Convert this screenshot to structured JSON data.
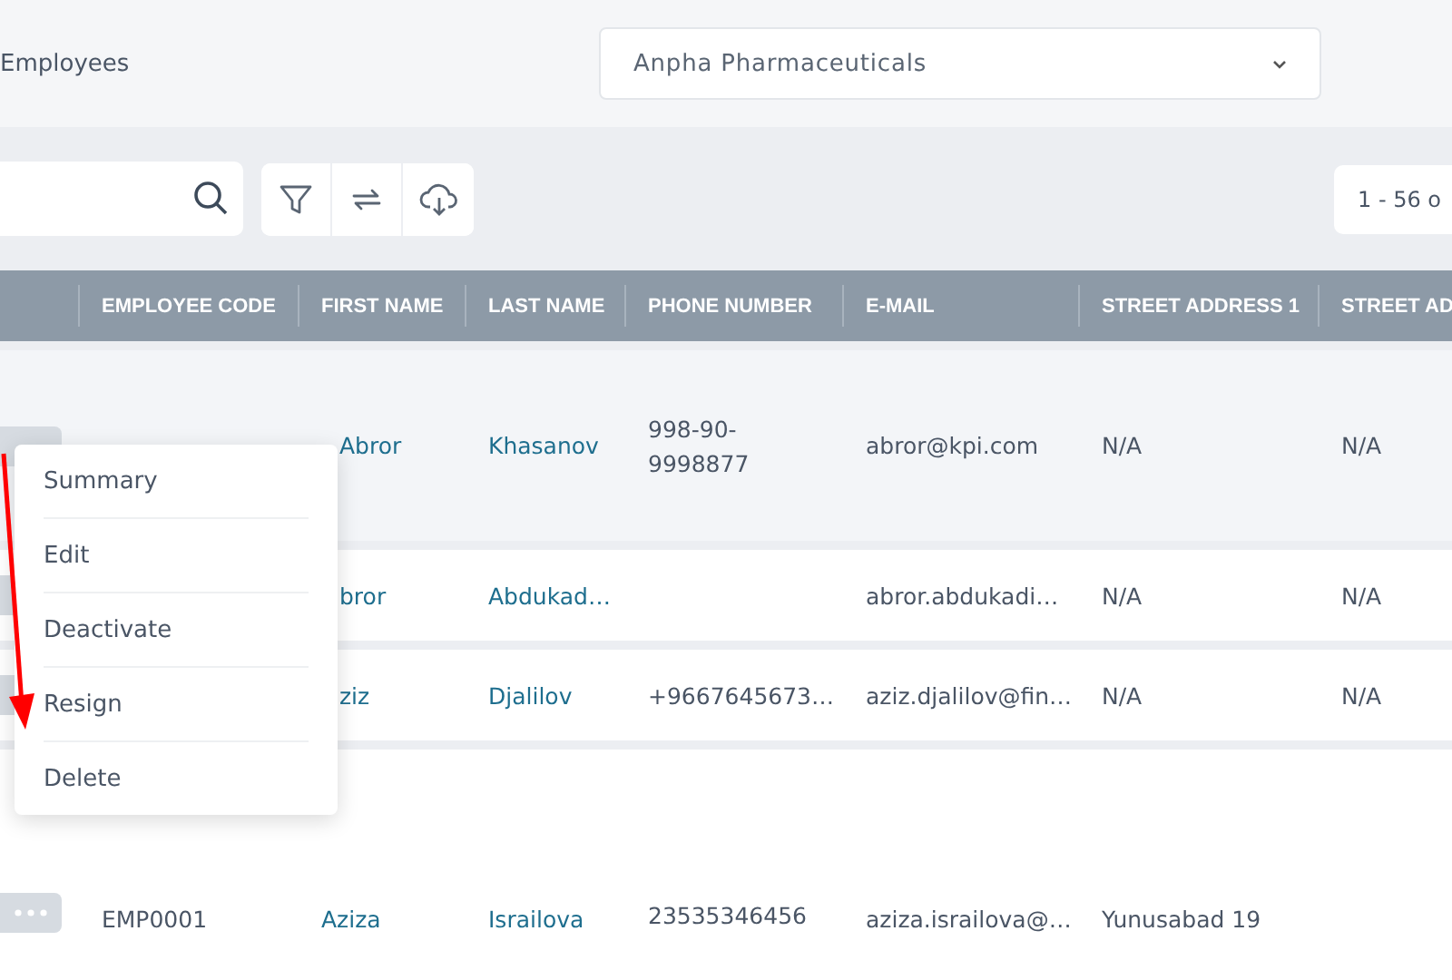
{
  "page": {
    "title": "Employees"
  },
  "company_select": {
    "value": "Anpha Pharmaceuticals"
  },
  "toolbar": {
    "buttons": [
      {
        "kind": "filter"
      },
      {
        "kind": "swap"
      },
      {
        "kind": "download"
      }
    ],
    "pagination": "1 - 56 o"
  },
  "table": {
    "columns": [
      "EMPLOYEE CODE",
      "FIRST NAME",
      "LAST NAME",
      "PHONE NUMBER",
      "E-MAIL",
      "STREET ADDRESS 1",
      "STREET AD"
    ],
    "rows": [
      {
        "kind": "menu-open",
        "cells": [
          "",
          "Abror",
          "Khasanov",
          "998-90-9998877",
          "abror@kpi.com",
          "N/A",
          "N/A"
        ]
      },
      {
        "kind": "covered",
        "cells": [
          "",
          "bror",
          "Abdukad…",
          "",
          "abror.abdukadi…",
          "N/A",
          "N/A"
        ]
      },
      {
        "kind": "covered",
        "cells": [
          "",
          "ziz",
          "Djalilov",
          "+9667645673…",
          "aziz.djalilov@fin…",
          "N/A",
          "N/A"
        ]
      },
      {
        "kind": "plain",
        "cells": [
          "EMP0001",
          "Aziza",
          "Israilova",
          "23535346456",
          "aziza.israilova@…",
          "Yunusabad 19",
          ""
        ]
      }
    ]
  },
  "row_menu": {
    "items": [
      "Summary",
      "Edit",
      "Deactivate",
      "Resign",
      "Delete"
    ]
  }
}
